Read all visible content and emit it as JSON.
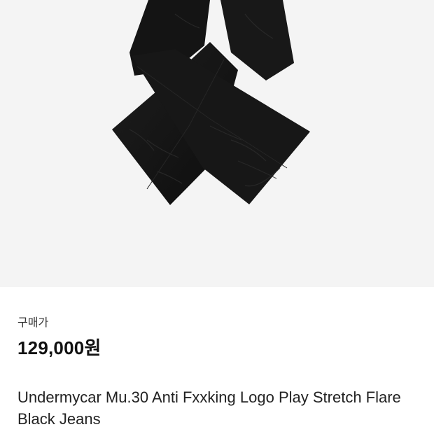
{
  "product": {
    "image_alt": "Black flare jeans laid in a crossed shape",
    "price_label": "구매가",
    "price": "129,000원",
    "name": "Undermycar Mu.30 Anti Fxxking Logo Play Stretch Flare Black Jeans"
  },
  "colors": {
    "image_background": "#f4f4f4",
    "jeans": "#161616",
    "page_background": "#ffffff"
  }
}
